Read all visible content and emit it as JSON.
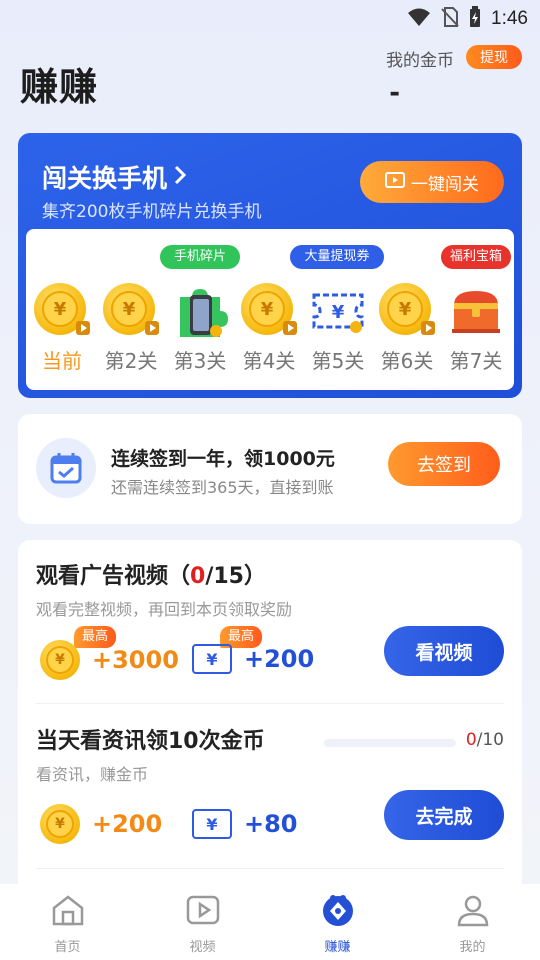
{
  "status_bar": {
    "time": "1:46"
  },
  "header": {
    "title": "赚赚",
    "coin_label": "我的金币",
    "coin_value": "-",
    "withdraw_label": "提现"
  },
  "challenge": {
    "title": "闯关换手机",
    "subtitle": "集齐200枚手机碎片兑换手机",
    "button_label": "一键闯关",
    "levels": [
      {
        "label": "当前",
        "type": "coin",
        "tag": ""
      },
      {
        "label": "第2关",
        "type": "coin",
        "tag": ""
      },
      {
        "label": "第3关",
        "type": "phone",
        "tag": "手机碎片",
        "tag_color": "#31c45a"
      },
      {
        "label": "第4关",
        "type": "coin",
        "tag": ""
      },
      {
        "label": "第5关",
        "type": "ticket",
        "tag": "大量提现券",
        "tag_color": "#2f5fe6"
      },
      {
        "label": "第6关",
        "type": "coin",
        "tag": ""
      },
      {
        "label": "第7关",
        "type": "chest",
        "tag": "福利宝箱",
        "tag_color": "#e8322c"
      }
    ]
  },
  "signin": {
    "title": "连续签到一年，领1000元",
    "subtitle": "还需连续签到365天，直接到账",
    "button_label": "去签到"
  },
  "tasks": [
    {
      "title_prefix": "观看广告视频（",
      "title_done": "0",
      "title_suffix": "/15）",
      "subtitle": "观看完整视频，再回到本页领取奖励",
      "coin_reward": "+3000",
      "ticket_reward": "+200",
      "badge": "最高",
      "button_label": "看视频"
    },
    {
      "title": "当天看资讯领10次金币",
      "subtitle": "看资讯，赚金币",
      "progress_done": "0",
      "progress_total": "/10",
      "progress": 0,
      "coin_reward": "+200",
      "ticket_reward": "+80",
      "button_label": "去完成"
    }
  ],
  "bottom_nav": [
    {
      "label": "首页",
      "icon": "home-icon"
    },
    {
      "label": "视频",
      "icon": "video-icon"
    },
    {
      "label": "赚赚",
      "icon": "earn-icon",
      "active": true
    },
    {
      "label": "我的",
      "icon": "profile-icon"
    }
  ],
  "colors": {
    "accent_blue": "#2450d6",
    "accent_orange": "#ff6a1c"
  }
}
